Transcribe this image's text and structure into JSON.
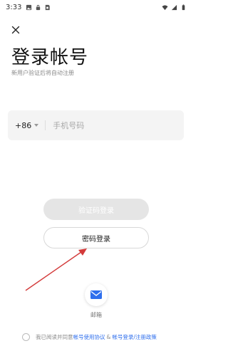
{
  "status_bar": {
    "time": "3:33"
  },
  "header": {
    "title": "登录帐号",
    "subtitle": "新用户验证后将自动注册"
  },
  "phone": {
    "country_code": "+86",
    "placeholder": "手机号码"
  },
  "buttons": {
    "code_login": "验证码登录",
    "password_login": "密码登录"
  },
  "email": {
    "label": "邮箱"
  },
  "agreement": {
    "prefix": "我已阅读并同意",
    "user_agreement": "帐号使用协议",
    "separator": "&",
    "privacy_policy": "帐号登录/注册政策"
  },
  "colors": {
    "accent": "#2f6fed",
    "annotation_arrow": "#d33a3a",
    "disabled_button": "#e5e5e5"
  }
}
